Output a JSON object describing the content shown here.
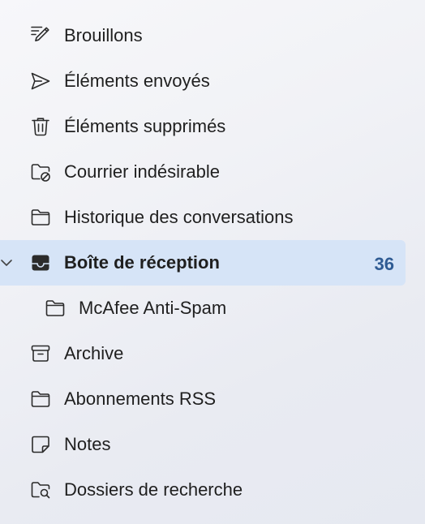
{
  "folders": [
    {
      "label": "Brouillons",
      "icon": "drafts-pencil-icon"
    },
    {
      "label": "Éléments envoyés",
      "icon": "send-icon"
    },
    {
      "label": "Éléments supprimés",
      "icon": "trash-icon"
    },
    {
      "label": "Courrier indésirable",
      "icon": "junk-folder-icon"
    },
    {
      "label": "Historique des conversations",
      "icon": "folder-icon"
    },
    {
      "label": "Boîte de réception",
      "icon": "inbox-icon",
      "count": "36",
      "selected": true,
      "expanded": true
    },
    {
      "label": "McAfee Anti-Spam",
      "icon": "folder-icon"
    },
    {
      "label": "Archive",
      "icon": "archive-icon"
    },
    {
      "label": "Abonnements RSS",
      "icon": "folder-icon"
    },
    {
      "label": "Notes",
      "icon": "note-icon"
    },
    {
      "label": "Dossiers de recherche",
      "icon": "search-folder-icon"
    }
  ],
  "colors": {
    "selected_background": "#d6e4f7",
    "count_text": "#2f5b93",
    "text": "#1f1f1f"
  }
}
